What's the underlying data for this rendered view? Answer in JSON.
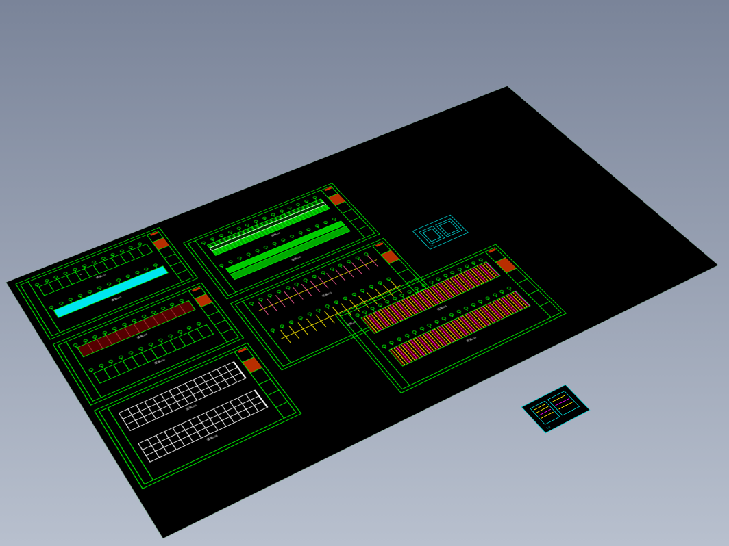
{
  "colors": {
    "outline": "#00ff00",
    "cyan": "#00e5ee",
    "red": "#cc3300",
    "white": "#ffffff",
    "yellow": "#ffee00",
    "magenta": "#ff00ff",
    "darkred": "#550000",
    "accent_cyan": "#00cccc"
  },
  "canvas": {
    "background": "#000000",
    "rotation": "isometric"
  },
  "sheets": [
    {
      "id": "A",
      "row": 0,
      "col": 0,
      "type": "plan-dual",
      "plans": [
        {
          "bays": 12,
          "fill": "outline",
          "marker": "circle"
        },
        {
          "bays": 12,
          "fill": "cyan"
        }
      ],
      "caption_top": "建施-01",
      "caption_bottom": "建施-02"
    },
    {
      "id": "B",
      "row": 1,
      "col": 0,
      "type": "plan-dual",
      "plans": [
        {
          "bays": 12,
          "fill": "darkred"
        },
        {
          "bays": 12,
          "fill": "outline"
        }
      ],
      "caption_top": "建施-03",
      "caption_bottom": "建施-04"
    },
    {
      "id": "C",
      "row": 2,
      "col": 0,
      "type": "plan-dual",
      "plans": [
        {
          "bays": 14,
          "fill": "white-grid"
        },
        {
          "bays": 14,
          "fill": "white-grid"
        }
      ],
      "caption_top": "建施-05",
      "caption_bottom": "建施-06"
    },
    {
      "id": "D",
      "row": 0,
      "col": 1,
      "type": "elevation-dual",
      "bands": [
        {
          "strips": 3,
          "fill": "green"
        },
        {
          "strips": 2,
          "fill": "green-solid"
        }
      ],
      "caption_top": "建施-07",
      "caption_bottom": "建施-08"
    },
    {
      "id": "E",
      "row": 1,
      "col": 1,
      "type": "layout-dual",
      "rows": [
        {
          "posts": 14,
          "color": "yellow"
        },
        {
          "posts": 14,
          "color": "yellow"
        }
      ],
      "accents": "magenta",
      "caption_top": "结施-01",
      "caption_bottom": "结施-02"
    },
    {
      "id": "F",
      "row": 2,
      "col": 1,
      "offset": true,
      "type": "section-dual",
      "plans": [
        {
          "bays": 18,
          "fill": "dense"
        },
        {
          "bays": 18,
          "fill": "dense"
        }
      ],
      "caption_top": "结施-03",
      "caption_bottom": "结施-04"
    }
  ],
  "mini_sheets": [
    {
      "id": "M1",
      "position": "upper-right",
      "cells": 2,
      "tag": "S-1"
    },
    {
      "id": "M2",
      "position": "lower-right-floating",
      "cells": 2,
      "tag": "S-2"
    }
  ]
}
